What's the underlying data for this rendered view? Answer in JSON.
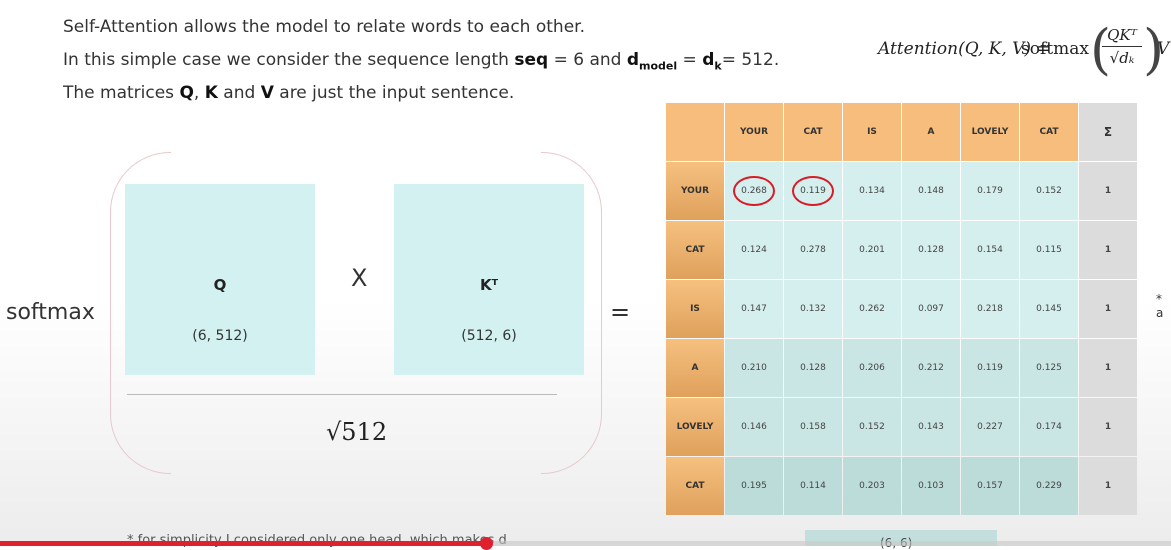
{
  "intro": {
    "line1": "Self-Attention allows the model to relate words to each other.",
    "line2_a": "In this simple case we consider the sequence length ",
    "line2_seq": "seq",
    "line2_b": " = 6 and ",
    "line2_d": "d",
    "line2_model": "model",
    "line2_c": " = ",
    "line2_dk": "d",
    "line2_k": "k",
    "line2_e": "= 512.",
    "line3_a": "The matrices ",
    "line3_q": "Q",
    "line3_sep1": ", ",
    "line3_k": "K",
    "line3_and": " and ",
    "line3_v": "V",
    "line3_b": " are just the input sentence."
  },
  "formula": {
    "lhs": "Attention(Q, K, V) =",
    "fn": "softmax",
    "numerator": "QKᵀ",
    "denominator": "√dₖ",
    "v": "V"
  },
  "softmax_label": "softmax",
  "q_matrix": {
    "name": "Q",
    "dim": "(6, 512)"
  },
  "kt_matrix": {
    "name": "Kᵀ",
    "dim": "(512, 6)"
  },
  "times": "X",
  "sqrt_text": "√512",
  "equals": "=",
  "table": {
    "columns": [
      "YOUR",
      "CAT",
      "IS",
      "A",
      "LOVELY",
      "CAT"
    ],
    "sum_header": "Σ",
    "rows": [
      {
        "label": "YOUR",
        "values": [
          "0.268",
          "0.119",
          "0.134",
          "0.148",
          "0.179",
          "0.152"
        ],
        "sum": "1"
      },
      {
        "label": "CAT",
        "values": [
          "0.124",
          "0.278",
          "0.201",
          "0.128",
          "0.154",
          "0.115"
        ],
        "sum": "1"
      },
      {
        "label": "IS",
        "values": [
          "0.147",
          "0.132",
          "0.262",
          "0.097",
          "0.218",
          "0.145"
        ],
        "sum": "1"
      },
      {
        "label": "A",
        "values": [
          "0.210",
          "0.128",
          "0.206",
          "0.212",
          "0.119",
          "0.125"
        ],
        "sum": "1"
      },
      {
        "label": "LOVELY",
        "values": [
          "0.146",
          "0.158",
          "0.152",
          "0.143",
          "0.227",
          "0.174"
        ],
        "sum": "1"
      },
      {
        "label": "CAT",
        "values": [
          "0.195",
          "0.114",
          "0.203",
          "0.103",
          "0.157",
          "0.229"
        ],
        "sum": "1"
      }
    ],
    "circled": [
      "0.268",
      "0.119"
    ]
  },
  "bottom_dim": "(6, 6)",
  "side_note": "* a",
  "footnote": "* for simplicity I considered only one head, which makes d",
  "colors": {
    "header_orange": "#f7bd7c",
    "cell_teal": "#d5efee",
    "matrix_teal": "#d2f1f0",
    "annotation_red": "#d81b25",
    "progress_red": "#e0202f"
  },
  "video_progress": 0.415
}
